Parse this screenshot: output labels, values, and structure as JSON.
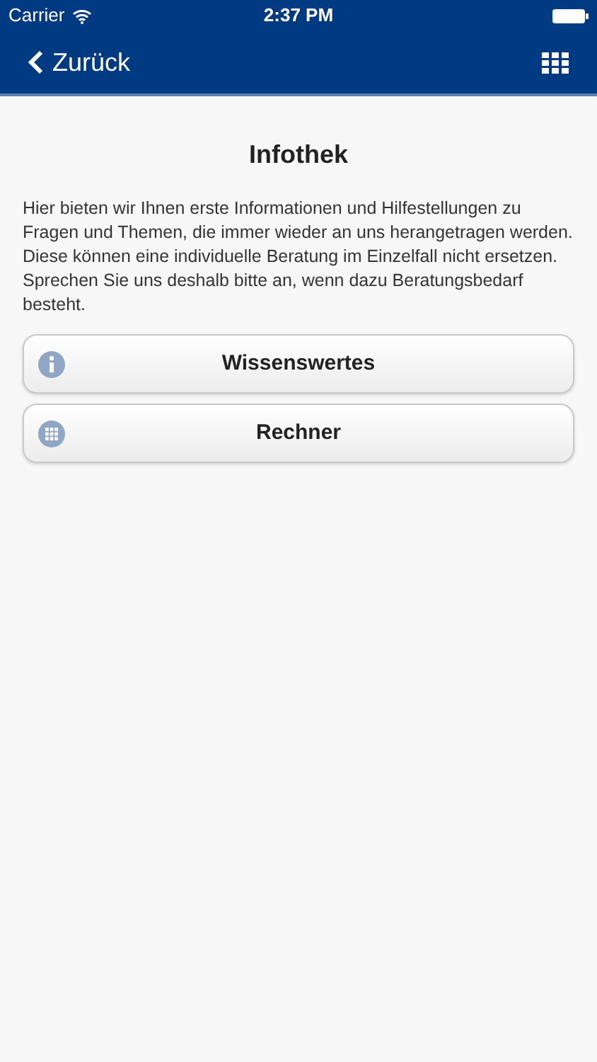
{
  "status_bar": {
    "carrier": "Carrier",
    "time": "2:37 PM"
  },
  "nav_bar": {
    "back_label": "Zurück"
  },
  "title": "Infothek",
  "intro": "Hier bieten wir Ihnen erste Informationen und Hilfestellungen zu Fragen und Themen, die immer wieder an uns herangetragen werden. Diese können eine individuelle Beratung im Einzelfall nicht ersetzen. Sprechen Sie uns deshalb bitte an, wenn dazu Beratungsbedarf besteht.",
  "buttons": [
    {
      "label": "Wissenswertes",
      "kind": "info"
    },
    {
      "label": "Rechner",
      "kind": "grid"
    }
  ]
}
